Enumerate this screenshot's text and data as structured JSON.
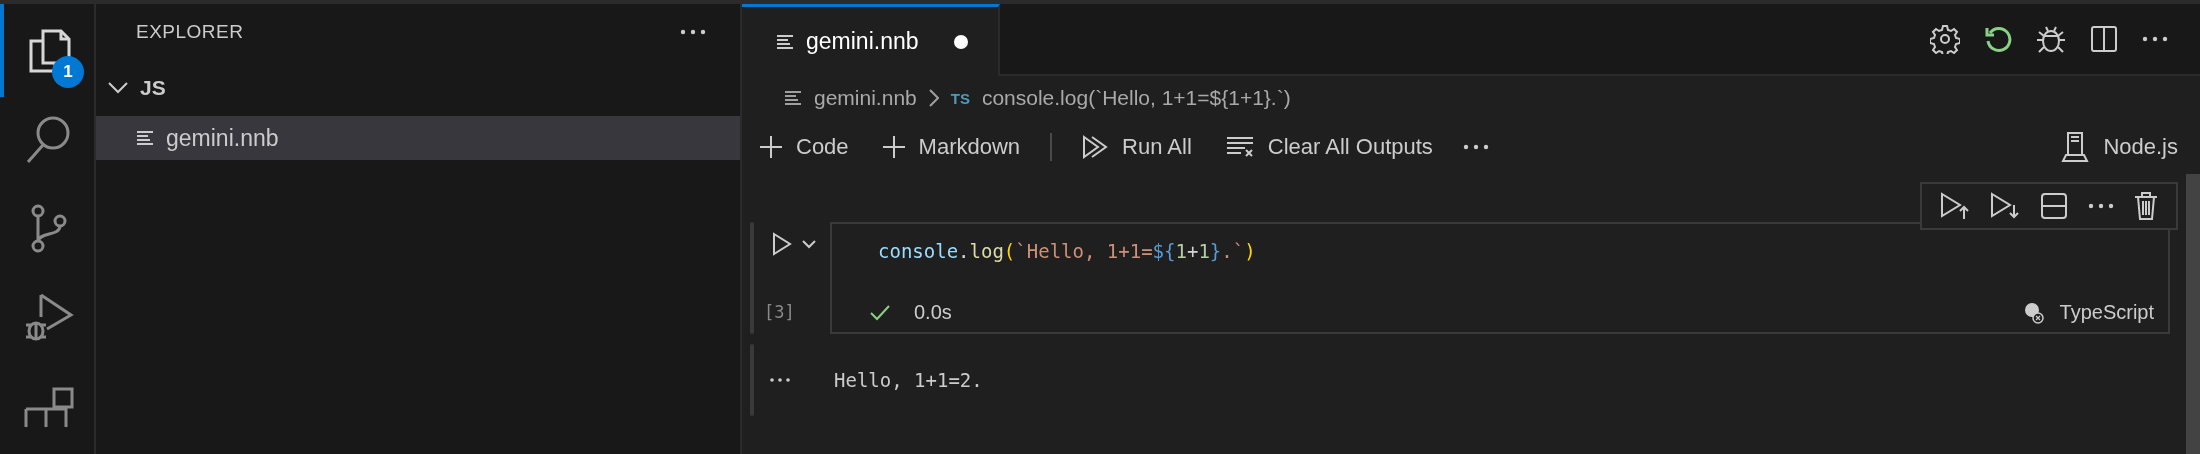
{
  "activity_bar": {
    "items": [
      {
        "kind": "explorer",
        "selected": true,
        "badge": "1"
      },
      {
        "kind": "search",
        "selected": false
      },
      {
        "kind": "source-control",
        "selected": false
      },
      {
        "kind": "run-debug",
        "selected": false
      },
      {
        "kind": "extensions",
        "selected": false
      }
    ]
  },
  "sidebar": {
    "title": "EXPLORER",
    "tree": [
      {
        "label": "JS",
        "expanded": true,
        "children": [
          {
            "label": "gemini.nnb",
            "selected": true
          }
        ]
      }
    ]
  },
  "editor": {
    "tabs": [
      {
        "label": "gemini.nnb",
        "selected": true,
        "dirty": true
      }
    ],
    "breadcrumbs": [
      {
        "kind": "file",
        "label": "gemini.nnb"
      },
      {
        "kind": "cell",
        "badge": "TS",
        "label": "console.log(`Hello, 1+1=${1+1}.`)"
      }
    ],
    "toolbar": [
      {
        "kind": "plus",
        "label": "Code"
      },
      {
        "kind": "plus",
        "label": "Markdown"
      },
      {
        "kind": "run-all",
        "label": "Run All"
      },
      {
        "kind": "clear",
        "label": "Clear All Outputs"
      }
    ],
    "kernel": "Node.js",
    "cells": [
      {
        "execution_count": "[3]",
        "succeeded": true,
        "duration": "0.0s",
        "language": "TypeScript",
        "output": "Hello, 1+1=2.",
        "code": [
          {
            "kind": "variable",
            "text": "console"
          },
          {
            "kind": "operator",
            "text": "."
          },
          {
            "kind": "function",
            "text": "log"
          },
          {
            "kind": "bracket",
            "text": "("
          },
          {
            "kind": "string",
            "text": "`Hello, 1+1="
          },
          {
            "kind": "interp",
            "text": "${"
          },
          {
            "kind": "number",
            "text": "1"
          },
          {
            "kind": "operator",
            "text": "+"
          },
          {
            "kind": "number",
            "text": "1"
          },
          {
            "kind": "interp",
            "text": "}"
          },
          {
            "kind": "string",
            "text": ".`"
          },
          {
            "kind": "bracket",
            "text": ")"
          }
        ]
      }
    ]
  }
}
